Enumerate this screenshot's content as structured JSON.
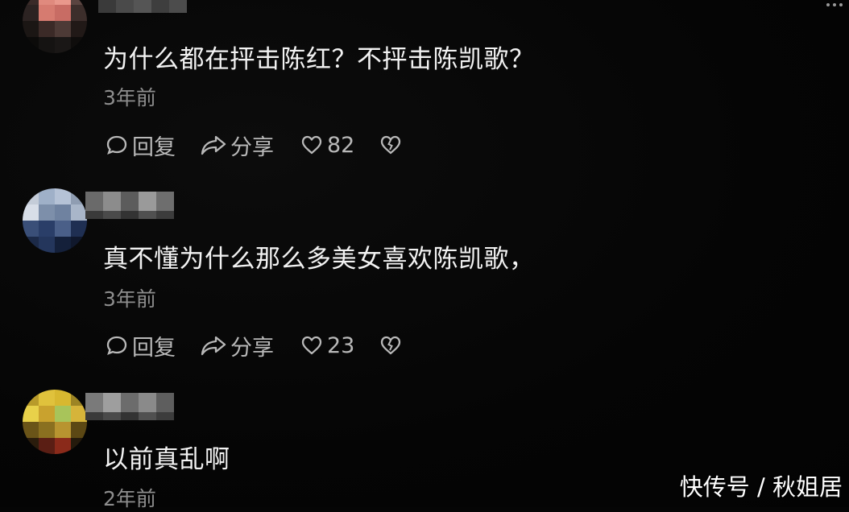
{
  "comments": [
    {
      "text": "为什么都在抨击陈红？不抨击陈凯歌？",
      "time": "3年前",
      "reply_label": "回复",
      "share_label": "分享",
      "likes": "82"
    },
    {
      "text": "真不懂为什么那么多美女喜欢陈凯歌，",
      "time": "3年前",
      "reply_label": "回复",
      "share_label": "分享",
      "likes": "23"
    },
    {
      "text": "以前真乱啊",
      "time": "2年前"
    }
  ],
  "watermark": "快传号 / 秋姐居",
  "icons": {
    "reply": "comment-bubble-icon",
    "share": "share-arrow-icon",
    "like": "heart-outline-icon",
    "dislike": "broken-heart-icon",
    "more": "more-dots-icon"
  },
  "colors": {
    "background": "#050505",
    "text": "#f2f2f2",
    "muted": "#8e8e8e",
    "action": "#b9b9b9",
    "watermark_bg": "#ffffff"
  }
}
